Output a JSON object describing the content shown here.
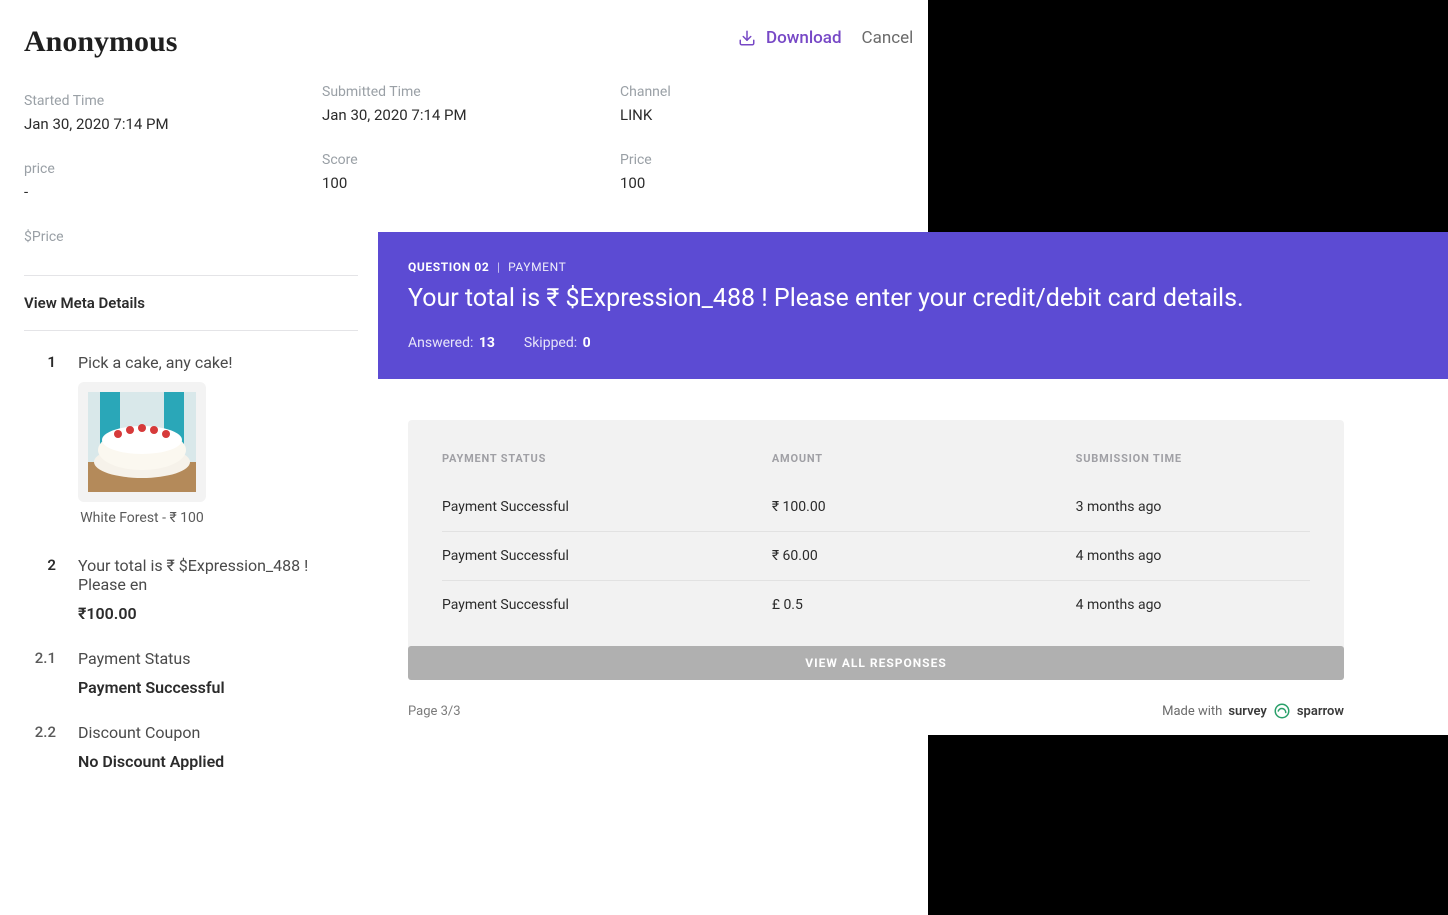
{
  "header": {
    "title": "Anonymous",
    "download_label": "Download",
    "cancel_label": "Cancel"
  },
  "meta": {
    "started_time_label": "Started Time",
    "started_time_value": "Jan 30, 2020 7:14 PM",
    "submitted_time_label": "Submitted Time",
    "submitted_time_value": "Jan 30, 2020 7:14 PM",
    "channel_label": "Channel",
    "channel_value": "LINK",
    "custom_price_label": "price",
    "custom_price_value": "-",
    "score_label": "Score",
    "score_value": "100",
    "price_label": "Price",
    "price_value": "100",
    "dollar_price_label": "$Price"
  },
  "view_meta_details": "View Meta Details",
  "questions": {
    "q1": {
      "num": "1",
      "title": "Pick a cake, any cake!",
      "caption": "White Forest - ₹ 100"
    },
    "q2": {
      "num": "2",
      "title": "Your total is ₹ $Expression_488 ! Please en",
      "answer": "₹100.00"
    },
    "q21": {
      "num": "2.1",
      "title": "Payment Status",
      "answer": "Payment Successful"
    },
    "q22": {
      "num": "2.2",
      "title": "Discount Coupon",
      "answer": "No Discount Applied"
    }
  },
  "banner": {
    "question_label": "QUESTION 02",
    "type_label": "PAYMENT",
    "text": "Your total is ₹ $Expression_488 ! Please enter your credit/debit card details.",
    "answered_label": "Answered:",
    "answered_value": "13",
    "skipped_label": "Skipped:",
    "skipped_value": "0"
  },
  "table": {
    "headers": {
      "status": "PAYMENT STATUS",
      "amount": "AMOUNT",
      "time": "SUBMISSION TIME"
    },
    "rows": [
      {
        "status": "Payment Successful",
        "amount": "₹ 100.00",
        "time": "3 months ago"
      },
      {
        "status": "Payment Successful",
        "amount": "₹ 60.00",
        "time": "4 months ago"
      },
      {
        "status": "Payment Successful",
        "amount": "£ 0.5",
        "time": "4 months ago"
      }
    ],
    "view_all": "VIEW ALL RESPONSES"
  },
  "footer": {
    "page": "Page 3/3",
    "made_with": "Made with",
    "brand1": "survey",
    "brand2": "sparrow"
  }
}
